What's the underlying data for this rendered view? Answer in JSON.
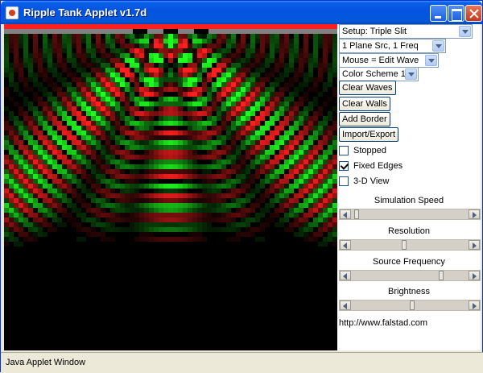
{
  "window": {
    "title": "Ripple Tank Applet v1.7d"
  },
  "controls": {
    "setup": "Setup: Triple Slit",
    "source": "1 Plane Src, 1 Freq",
    "mouse": "Mouse = Edit Wave",
    "color_scheme": "Color Scheme 1",
    "clear_waves": "Clear Waves",
    "clear_walls": "Clear Walls",
    "add_border": "Add Border",
    "import_export": "Import/Export",
    "stopped": "Stopped",
    "fixed_edges": "Fixed Edges",
    "view_3d": "3-D View"
  },
  "checks": {
    "stopped": false,
    "fixed_edges": true,
    "view_3d": false
  },
  "sliders": [
    {
      "label": "Simulation Speed",
      "value": 0.02
    },
    {
      "label": "Resolution",
      "value": 0.45
    },
    {
      "label": "Source Frequency",
      "value": 0.78
    },
    {
      "label": "Brightness",
      "value": 0.52
    }
  ],
  "url": "http://www.falstad.com",
  "status": "Java Applet Window",
  "colors": {
    "wave_positive": "#ff1f1f",
    "wave_negative": "#1fff1f",
    "background": "#000000",
    "wall": "#808080"
  }
}
